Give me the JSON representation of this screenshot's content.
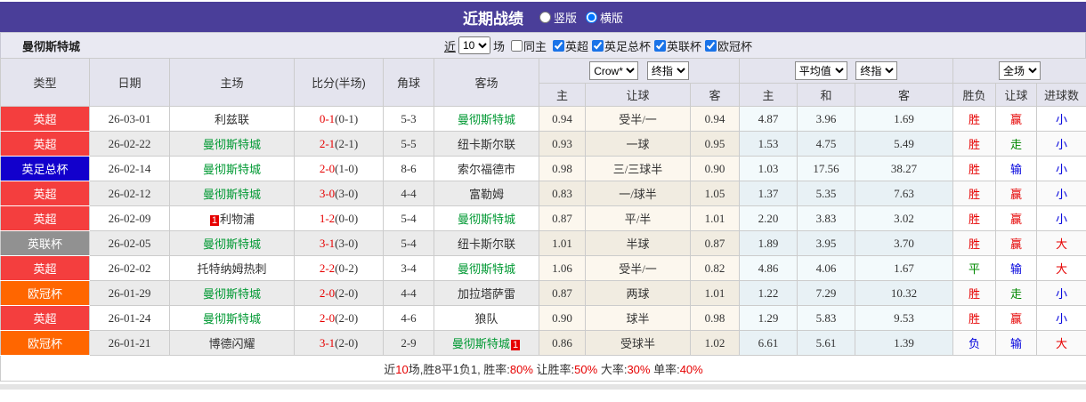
{
  "titlebar": {
    "title": "近期战绩",
    "radios": [
      {
        "label": "竖版",
        "selected": false
      },
      {
        "label": "横版",
        "selected": true
      }
    ]
  },
  "filterbar": {
    "team": "曼彻斯特城",
    "recent_prefix": "近",
    "recent_count": "10",
    "recent_suffix": "场",
    "same_home_label": "同主",
    "same_home_checked": false,
    "leagues": [
      {
        "label": "英超",
        "checked": true
      },
      {
        "label": "英足总杯",
        "checked": true
      },
      {
        "label": "英联杯",
        "checked": true
      },
      {
        "label": "欧冠杯",
        "checked": true
      }
    ]
  },
  "table": {
    "left_headers": [
      "类型",
      "日期",
      "主场",
      "比分(半场)",
      "角球",
      "客场"
    ],
    "groups": [
      {
        "dropdowns": [
          "Crow*",
          "终指"
        ],
        "sub": [
          "主",
          "让球",
          "客"
        ]
      },
      {
        "dropdowns": [
          "平均值",
          "终指"
        ],
        "sub": [
          "主",
          "和",
          "客"
        ]
      },
      {
        "dropdowns": [
          "全场"
        ],
        "sub": [
          "胜负",
          "让球",
          "进球数"
        ]
      }
    ],
    "rows": [
      {
        "league": "英超",
        "date": "26-03-01",
        "home": "利兹联",
        "home_self": false,
        "home_badge": "",
        "score": "0-1",
        "half": "(0-1)",
        "corners": "5-3",
        "away": "曼彻斯特城",
        "away_self": true,
        "away_badge": "",
        "odds1": [
          "0.94",
          "受半/一",
          "0.94"
        ],
        "odds2": [
          "4.87",
          "3.96",
          "1.69"
        ],
        "results": [
          {
            "text": "胜",
            "color": "red"
          },
          {
            "text": "赢",
            "color": "red"
          },
          {
            "text": "小",
            "color": "blue"
          }
        ]
      },
      {
        "league": "英超",
        "date": "26-02-22",
        "home": "曼彻斯特城",
        "home_self": true,
        "home_badge": "",
        "score": "2-1",
        "half": "(2-1)",
        "corners": "5-5",
        "away": "纽卡斯尔联",
        "away_self": false,
        "away_badge": "",
        "odds1": [
          "0.93",
          "一球",
          "0.95"
        ],
        "odds2": [
          "1.53",
          "4.75",
          "5.49"
        ],
        "results": [
          {
            "text": "胜",
            "color": "red"
          },
          {
            "text": "走",
            "color": "green"
          },
          {
            "text": "小",
            "color": "blue"
          }
        ]
      },
      {
        "league": "英足总杯",
        "date": "26-02-14",
        "home": "曼彻斯特城",
        "home_self": true,
        "home_badge": "",
        "score": "2-0",
        "half": "(1-0)",
        "corners": "8-6",
        "away": "索尔福德市",
        "away_self": false,
        "away_badge": "",
        "odds1": [
          "0.98",
          "三/三球半",
          "0.90"
        ],
        "odds2": [
          "1.03",
          "17.56",
          "38.27"
        ],
        "results": [
          {
            "text": "胜",
            "color": "red"
          },
          {
            "text": "输",
            "color": "blue"
          },
          {
            "text": "小",
            "color": "blue"
          }
        ]
      },
      {
        "league": "英超",
        "date": "26-02-12",
        "home": "曼彻斯特城",
        "home_self": true,
        "home_badge": "",
        "score": "3-0",
        "half": "(3-0)",
        "corners": "4-4",
        "away": "富勒姆",
        "away_self": false,
        "away_badge": "",
        "odds1": [
          "0.83",
          "一/球半",
          "1.05"
        ],
        "odds2": [
          "1.37",
          "5.35",
          "7.63"
        ],
        "results": [
          {
            "text": "胜",
            "color": "red"
          },
          {
            "text": "赢",
            "color": "red"
          },
          {
            "text": "小",
            "color": "blue"
          }
        ]
      },
      {
        "league": "英超",
        "date": "26-02-09",
        "home": "利物浦",
        "home_self": false,
        "home_badge": "1",
        "score": "1-2",
        "half": "(0-0)",
        "corners": "5-4",
        "away": "曼彻斯特城",
        "away_self": true,
        "away_badge": "",
        "odds1": [
          "0.87",
          "平/半",
          "1.01"
        ],
        "odds2": [
          "2.20",
          "3.83",
          "3.02"
        ],
        "results": [
          {
            "text": "胜",
            "color": "red"
          },
          {
            "text": "赢",
            "color": "red"
          },
          {
            "text": "小",
            "color": "blue"
          }
        ]
      },
      {
        "league": "英联杯",
        "date": "26-02-05",
        "home": "曼彻斯特城",
        "home_self": true,
        "home_badge": "",
        "score": "3-1",
        "half": "(3-0)",
        "corners": "5-4",
        "away": "纽卡斯尔联",
        "away_self": false,
        "away_badge": "",
        "odds1": [
          "1.01",
          "半球",
          "0.87"
        ],
        "odds2": [
          "1.89",
          "3.95",
          "3.70"
        ],
        "results": [
          {
            "text": "胜",
            "color": "red"
          },
          {
            "text": "赢",
            "color": "red"
          },
          {
            "text": "大",
            "color": "red"
          }
        ]
      },
      {
        "league": "英超",
        "date": "26-02-02",
        "home": "托特纳姆热刺",
        "home_self": false,
        "home_badge": "",
        "score": "2-2",
        "half": "(0-2)",
        "corners": "3-4",
        "away": "曼彻斯特城",
        "away_self": true,
        "away_badge": "",
        "odds1": [
          "1.06",
          "受半/一",
          "0.82"
        ],
        "odds2": [
          "4.86",
          "4.06",
          "1.67"
        ],
        "results": [
          {
            "text": "平",
            "color": "green"
          },
          {
            "text": "输",
            "color": "blue"
          },
          {
            "text": "大",
            "color": "red"
          }
        ]
      },
      {
        "league": "欧冠杯",
        "date": "26-01-29",
        "home": "曼彻斯特城",
        "home_self": true,
        "home_badge": "",
        "score": "2-0",
        "half": "(2-0)",
        "corners": "4-4",
        "away": "加拉塔萨雷",
        "away_self": false,
        "away_badge": "",
        "odds1": [
          "0.87",
          "两球",
          "1.01"
        ],
        "odds2": [
          "1.22",
          "7.29",
          "10.32"
        ],
        "results": [
          {
            "text": "胜",
            "color": "red"
          },
          {
            "text": "走",
            "color": "green"
          },
          {
            "text": "小",
            "color": "blue"
          }
        ]
      },
      {
        "league": "英超",
        "date": "26-01-24",
        "home": "曼彻斯特城",
        "home_self": true,
        "home_badge": "",
        "score": "2-0",
        "half": "(2-0)",
        "corners": "4-6",
        "away": "狼队",
        "away_self": false,
        "away_badge": "",
        "odds1": [
          "0.90",
          "球半",
          "0.98"
        ],
        "odds2": [
          "1.29",
          "5.83",
          "9.53"
        ],
        "results": [
          {
            "text": "胜",
            "color": "red"
          },
          {
            "text": "赢",
            "color": "red"
          },
          {
            "text": "小",
            "color": "blue"
          }
        ]
      },
      {
        "league": "欧冠杯",
        "date": "26-01-21",
        "home": "博德闪耀",
        "home_self": false,
        "home_badge": "",
        "score": "3-1",
        "half": "(2-0)",
        "corners": "2-9",
        "away": "曼彻斯特城",
        "away_self": true,
        "away_badge": "1",
        "odds1": [
          "0.86",
          "受球半",
          "1.02"
        ],
        "odds2": [
          "6.61",
          "5.61",
          "1.39"
        ],
        "results": [
          {
            "text": "负",
            "color": "blue"
          },
          {
            "text": "输",
            "color": "blue"
          },
          {
            "text": "大",
            "color": "red"
          }
        ]
      }
    ]
  },
  "footer": {
    "segments": [
      {
        "text": "近",
        "color": "dark"
      },
      {
        "text": "10",
        "color": "red"
      },
      {
        "text": "场,胜8平1负1, 胜率:",
        "color": "dark"
      },
      {
        "text": "80%",
        "color": "red"
      },
      {
        "text": " 让胜率:",
        "color": "dark"
      },
      {
        "text": "50%",
        "color": "red"
      },
      {
        "text": " 大率:",
        "color": "dark"
      },
      {
        "text": "30%",
        "color": "red"
      },
      {
        "text": " 单率:",
        "color": "dark"
      },
      {
        "text": "40%",
        "color": "red"
      }
    ]
  },
  "colors": {
    "header_purple": "#4a3e99",
    "league_colors": {
      "英超": "#f43e3e",
      "英足总杯": "#1200cc",
      "英联杯": "#919191",
      "欧冠杯": "#ff6600"
    },
    "score_red": "#e60000",
    "result_red": "#e60000",
    "result_green": "#008800",
    "result_blue": "#0000dd",
    "self_team_green": "#009933"
  }
}
